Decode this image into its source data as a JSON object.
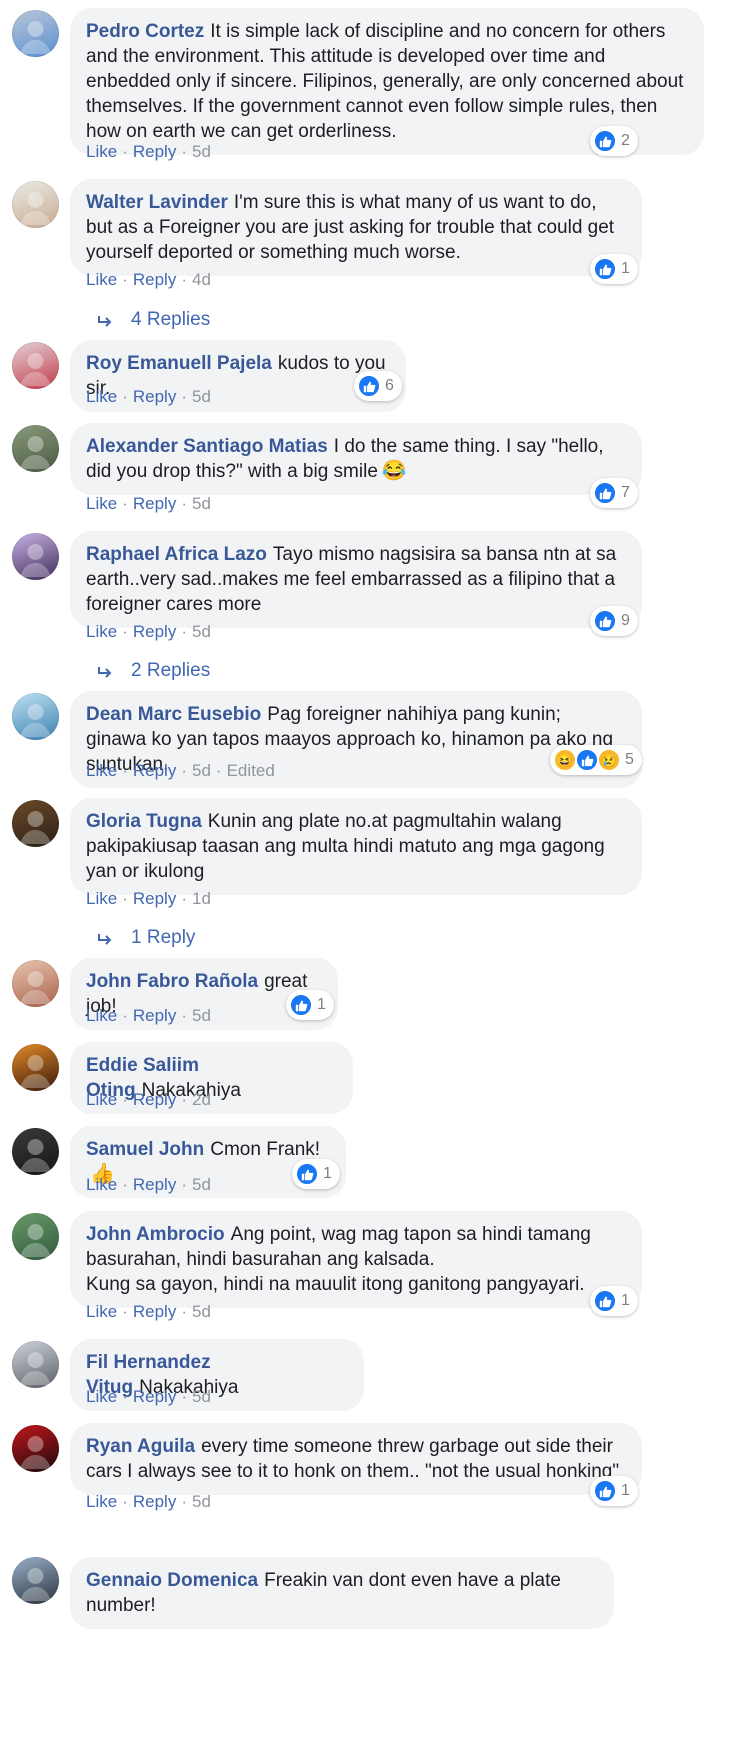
{
  "labels": {
    "like": "Like",
    "reply": "Reply",
    "sep": "·"
  },
  "colors": {
    "name": "#385898",
    "link": "#4267b2",
    "bubble": "#f2f3f5",
    "like_blue": "#1877f2"
  },
  "comments": [
    {
      "id": "pedro-cortez",
      "author": "Pedro Cortez",
      "text": "It is simple lack of discipline and no concern for others and the environment. This attitude is developed over time and enbedded only if sincere. Filipinos, generally, are only concerned about themselves. If the government cannot even follow simple rules, then how on earth we can get orderliness.",
      "time": "5d",
      "reactions": {
        "types": [
          "like"
        ],
        "count": "2"
      },
      "avatar": {
        "colors": [
          "#b9c6d8",
          "#5a8fd0"
        ],
        "icon": "landscape-avatar-icon"
      }
    },
    {
      "id": "walter-lavinder",
      "author": "Walter Lavinder",
      "text": "I'm sure this is what many of us want to do, but as a Foreigner you are just asking for trouble that could get yourself deported or something much worse.",
      "time": "4d",
      "reactions": {
        "types": [
          "like"
        ],
        "count": "1"
      },
      "replies": "4 Replies",
      "avatar": {
        "colors": [
          "#e9ece8",
          "#c9a98f"
        ],
        "icon": "person-avatar-icon"
      }
    },
    {
      "id": "roy-emanuell-pajela",
      "author": "Roy Emanuell Pajela",
      "text": "kudos to you sir.",
      "time": "5d",
      "reactions": {
        "types": [
          "like"
        ],
        "count": "6"
      },
      "avatar": {
        "colors": [
          "#e5d3d6",
          "#c0394a"
        ],
        "icon": "couple-avatar-icon"
      }
    },
    {
      "id": "alexander-santiago-matias",
      "author": "Alexander Santiago Matias",
      "text": "I do the same thing. I say \"hello, did you drop this?\" with a big smile",
      "emoji": "😂",
      "time": "5d",
      "reactions": {
        "types": [
          "like"
        ],
        "count": "7"
      },
      "avatar": {
        "colors": [
          "#8a9a7a",
          "#4a5a44"
        ],
        "icon": "motorcycle-avatar-icon"
      }
    },
    {
      "id": "raphael-africa-lazo",
      "author": "Raphael Africa Lazo",
      "text": "Tayo mismo nagsisira sa bansa ntn at sa earth..very sad..makes me feel embarrassed as a filipino that a foreigner cares more",
      "time": "5d",
      "reactions": {
        "types": [
          "like"
        ],
        "count": "9"
      },
      "replies": "2 Replies",
      "avatar": {
        "colors": [
          "#c9b3e6",
          "#3d2c5a"
        ],
        "icon": "person-avatar-icon"
      }
    },
    {
      "id": "dean-marc-eusebio",
      "author": "Dean Marc Eusebio",
      "text": "Pag foreigner nahihiya pang kunin; ginawa ko yan tapos maayos approach ko, hinamon pa ako ng suntukan.",
      "time": "5d",
      "edited": "Edited",
      "reactions": {
        "types": [
          "haha",
          "like",
          "sad"
        ],
        "count": "5"
      },
      "avatar": {
        "colors": [
          "#bfe3f3",
          "#3a7fb0"
        ],
        "icon": "ferris-wheel-avatar-icon"
      }
    },
    {
      "id": "gloria-tugna",
      "author": "Gloria Tugna",
      "text": "Kunin ang plate no.at pagmultahin walang pakipakiusap taasan ang multa hindi matuto ang mga gagong yan or ikulong",
      "time": "1d",
      "replies": "1 Reply",
      "avatar": {
        "colors": [
          "#6b4a2a",
          "#2a1f14"
        ],
        "icon": "person-avatar-icon"
      }
    },
    {
      "id": "john-fabro-ranola",
      "author": "John Fabro Rañola",
      "text": "great job!",
      "time": "5d",
      "reactions": {
        "types": [
          "like"
        ],
        "count": "1"
      },
      "avatar": {
        "colors": [
          "#e8c6b0",
          "#a8604a"
        ],
        "icon": "face-avatar-icon"
      }
    },
    {
      "id": "eddie-saliim-oting",
      "author": "Eddie Saliim Oting",
      "text": "Nakakahiya",
      "time": "2d",
      "avatar": {
        "colors": [
          "#e48a2a",
          "#3a1a0a"
        ],
        "icon": "sunset-avatar-icon"
      }
    },
    {
      "id": "samuel-john",
      "author": "Samuel John",
      "text": "Cmon Frank!",
      "emoji": "👍",
      "time": "5d",
      "reactions": {
        "types": [
          "like"
        ],
        "count": "1"
      },
      "avatar": {
        "colors": [
          "#3a3a3a",
          "#151515"
        ],
        "icon": "person-avatar-icon"
      }
    },
    {
      "id": "john-ambrocio",
      "author": "John Ambrocio",
      "text": "Ang point, wag mag tapon sa hindi tamang basurahan, hindi basurahan ang kalsada.\nKung sa gayon, hindi na mauulit itong ganitong pangyayari.",
      "time": "5d",
      "reactions": {
        "types": [
          "like"
        ],
        "count": "1"
      },
      "avatar": {
        "colors": [
          "#6a9a6a",
          "#2f5a3a"
        ],
        "icon": "landscape-avatar-icon"
      }
    },
    {
      "id": "fil-hernandez-vitug",
      "author": "Fil Hernandez Vitug",
      "text": "Nakakahiya",
      "time": "5d",
      "avatar": {
        "colors": [
          "#cfd5dc",
          "#5a5f66"
        ],
        "icon": "person-avatar-icon"
      }
    },
    {
      "id": "ryan-aguila",
      "author": "Ryan Aguila",
      "text": "every time someone threw garbage out side their cars I always see to it to honk on them.. \"not the usual honking\"",
      "time": "5d",
      "reactions": {
        "types": [
          "like"
        ],
        "count": "1"
      },
      "avatar": {
        "colors": [
          "#c4161c",
          "#1a0a0a"
        ],
        "icon": "eagle-logo-avatar-icon"
      }
    },
    {
      "id": "gennaio-domenica",
      "author": "Gennaio Domenica",
      "text": "Freakin van dont even have a plate number!",
      "avatar": {
        "colors": [
          "#9ab0c8",
          "#2a3440"
        ],
        "icon": "palm-tree-avatar-icon"
      }
    }
  ]
}
